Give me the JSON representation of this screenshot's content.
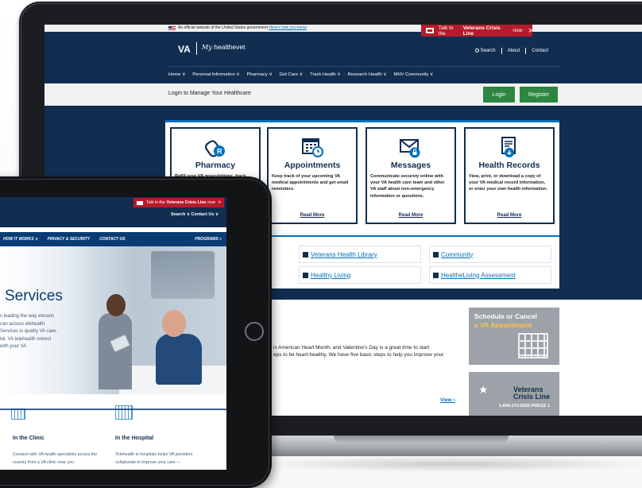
{
  "laptop": {
    "gov_banner": {
      "text": "An official website of the United States government",
      "link": "Here's how you know"
    },
    "crisis_line": {
      "prefix": "Talk to the",
      "bold": "Veterans Crisis Line",
      "suffix": "now",
      "arrow": ">"
    },
    "logo": {
      "va": "VA",
      "mhv_prefix": "My",
      "mhv_main": "healthevet"
    },
    "top_links": {
      "search": "Search",
      "about": "About",
      "contact": "Contact"
    },
    "nav": [
      "Home ∨",
      "Personal Information ∨",
      "Pharmacy ∨",
      "Get Care ∨",
      "Track Health ∨",
      "Research Health ∨",
      "MHV Community ∨"
    ],
    "login_strip": {
      "label": "Login to Manage Your Healthcare",
      "login": "Login",
      "register": "Register"
    },
    "cards": [
      {
        "title": "Pharmacy",
        "text": "Refill your VA prescriptions, track",
        "more": "",
        "icon": "pill-bottle-icon"
      },
      {
        "title": "Appointments",
        "text": "Keep track of your upcoming VA medical appointments and get email reminders.",
        "more": "Read More",
        "icon": "calendar-clock-icon"
      },
      {
        "title": "Messages",
        "text": "Communicate securely online with your VA health care team and other VA staff about non-emergency information or questions.",
        "more": "Read More",
        "icon": "envelope-lock-icon"
      },
      {
        "title": "Health Records",
        "text": "View, print, or download a copy of your VA medical record information, or enter your own health information.",
        "more": "Read More",
        "icon": "download-record-icon"
      }
    ],
    "quick_links": [
      {
        "label": "Veterans Health Library",
        "icon": "book-icon"
      },
      {
        "label": "Community",
        "icon": "community-icon"
      },
      {
        "label": "Healthy Living",
        "icon": "runner-icon"
      },
      {
        "label": "HealtheLiving Assessment",
        "icon": "assessment-icon"
      }
    ],
    "article": {
      "line1": "is American Heart Month, and Valentine's Day is a great time to start",
      "line2": "eps to be heart-healthy. We have five basic steps to help you improve your",
      "view": "View ›"
    },
    "promo_schedule": {
      "line1": "Schedule or Cancel",
      "line2": "a VA Appointment"
    },
    "promo_crisis": {
      "line1": "Veterans",
      "line2": "Crisis Line",
      "phone": "1-800-273-8255 PRESS 1"
    }
  },
  "tablet": {
    "crisis_line": {
      "prefix": "Talk to the",
      "bold": "Veterans Crisis Line",
      "suffix": "now",
      "arrow": ">"
    },
    "top_links": "Search ∨   Contact Us ∨",
    "nav": [
      "HOW IT WORKS ∨",
      "PRIVACY & SECURITY",
      "CONTACT US"
    ],
    "programs": "PROGRAMS ≡",
    "hero": {
      "title": "Services",
      "text": "s leading the way eterans can access elehealth Services is quality VA care. tal, VA telehealth onnect with your VA"
    },
    "sections": [
      {
        "title": "In the Clinic",
        "text": "Connect with VA health specialists across the country from a VA clinic near you"
      },
      {
        "title": "In the Hospital",
        "text": "Telehealth in hospitals helps VA providers collaborate to improve your care —"
      }
    ]
  },
  "colors": {
    "va_navy": "#112e51",
    "crisis_red": "#b51c2b",
    "green": "#2e8540",
    "link_blue": "#0071bb"
  }
}
